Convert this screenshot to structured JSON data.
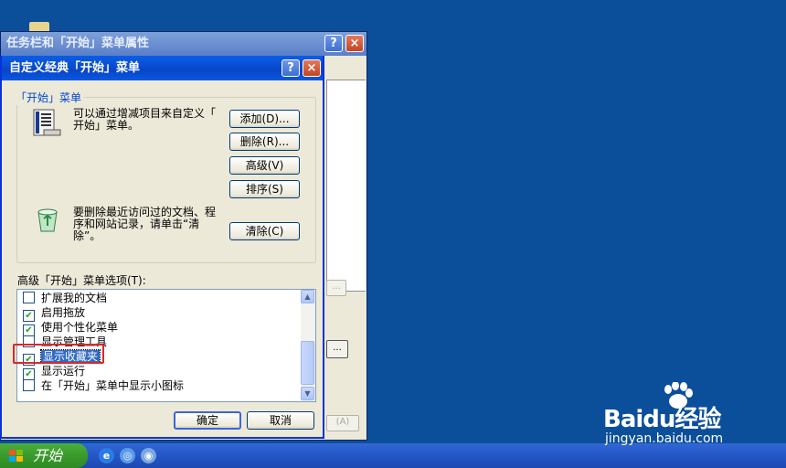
{
  "back_window": {
    "title": "任务栏和「开始」菜单属性",
    "help_glyph": "?",
    "close_glyph": "×",
    "button1": "...",
    "button2": "...",
    "apply_hotkey": "(A)"
  },
  "dialog": {
    "title": "自定义经典「开始」菜单",
    "help_glyph": "?",
    "close_glyph": "×",
    "group_title": "「开始」菜单",
    "description_line1": "可以通过增减项目来自定义「",
    "description_line2": "开始」菜单。",
    "clear_line1": "要删除最近访问过的文档、程",
    "clear_line2": "序和网站记录，请单击“清",
    "clear_line3": "除”。",
    "buttons": {
      "add": "添加(D)...",
      "remove": "删除(R)...",
      "advanced": "高级(V)",
      "sort": "排序(S)",
      "clear": "清除(C)",
      "ok": "确定",
      "cancel": "取消"
    },
    "options_label": "高级「开始」菜单选项(T):",
    "options": [
      {
        "label": "扩展我的文档",
        "checked": false
      },
      {
        "label": "启用拖放",
        "checked": true
      },
      {
        "label": "使用个性化菜单",
        "checked": true
      },
      {
        "label": "显示管理工具",
        "checked": false
      },
      {
        "label": "显示收藏夹",
        "checked": true,
        "selected": true
      },
      {
        "label": "显示运行",
        "checked": true
      },
      {
        "label": "在「开始」菜单中显示小图标",
        "checked": false
      }
    ],
    "check_glyph": "✔",
    "scroll_up_glyph": "▲",
    "scroll_down_glyph": "▼"
  },
  "taskbar": {
    "start_label": "开始",
    "quick_launch": [
      "e",
      "◎",
      "◉"
    ]
  },
  "watermark": {
    "brand": "Baidu经验",
    "url": "jingyan.baidu.com"
  }
}
